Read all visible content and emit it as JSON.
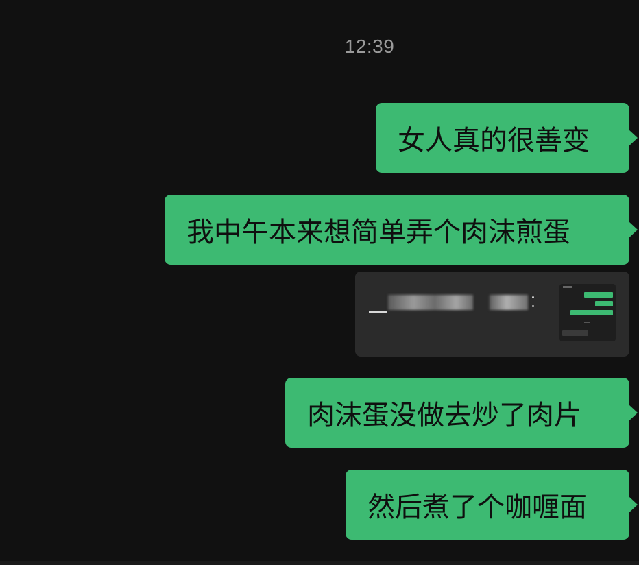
{
  "chat": {
    "timestamp": "12:39",
    "messages": [
      {
        "sender": "self",
        "type": "text",
        "text": "女人真的很善变"
      },
      {
        "sender": "self",
        "type": "text",
        "text": "我中午本来想简单弄个肉沫煎蛋"
      },
      {
        "sender": "self",
        "type": "image",
        "text": ""
      },
      {
        "sender": "self",
        "type": "text",
        "text": "肉沫蛋没做去炒了肉片"
      },
      {
        "sender": "self",
        "type": "text",
        "text": "然后煮了个咖喱面"
      }
    ]
  },
  "colors": {
    "background": "#111111",
    "self_bubble": "#3dba72",
    "timestamp_text": "#9a9a9a",
    "card_background": "#2b2b2b"
  }
}
